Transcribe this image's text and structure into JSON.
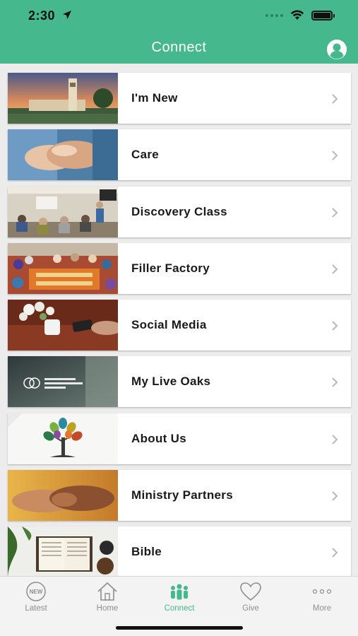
{
  "status": {
    "time": "2:30"
  },
  "nav": {
    "title": "Connect"
  },
  "items": [
    {
      "label": "I'm New"
    },
    {
      "label": "Care"
    },
    {
      "label": "Discovery Class"
    },
    {
      "label": "Filler Factory"
    },
    {
      "label": "Social Media"
    },
    {
      "label": "My Live Oaks"
    },
    {
      "label": "About Us"
    },
    {
      "label": "Ministry Partners"
    },
    {
      "label": "Bible"
    }
  ],
  "tabs": [
    {
      "label": "Latest",
      "icon": "new-badge-icon"
    },
    {
      "label": "Home",
      "icon": "home-icon"
    },
    {
      "label": "Connect",
      "icon": "people-icon",
      "active": true
    },
    {
      "label": "Give",
      "icon": "heart-icon"
    },
    {
      "label": "More",
      "icon": "more-dots-icon"
    }
  ],
  "colors": {
    "brand": "#45b98d",
    "tab_inactive": "#8e8e8e"
  }
}
